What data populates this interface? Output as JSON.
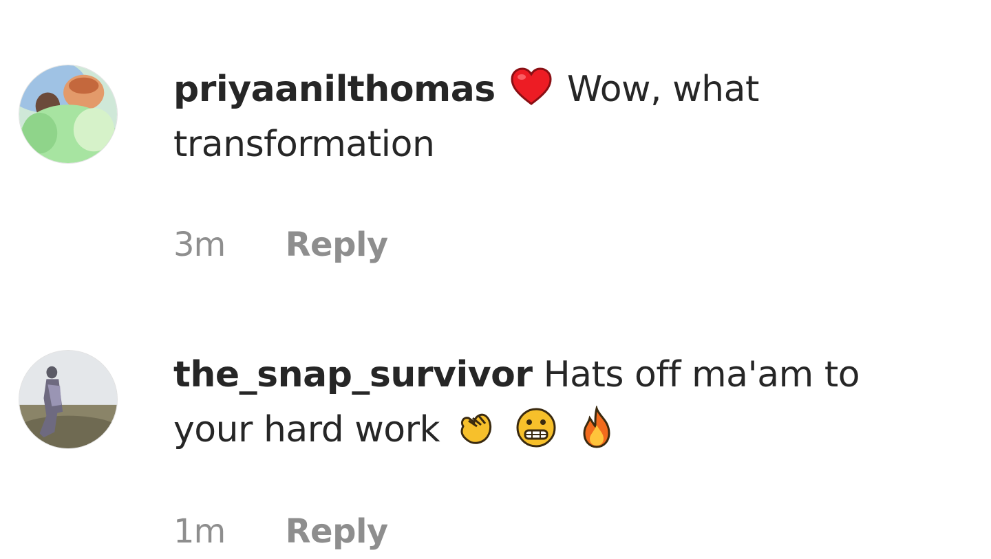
{
  "comments": [
    {
      "username": "priyaanilthomas",
      "emoji_after_username": "red-heart-icon",
      "text_line1": "Wow, what",
      "text_line2": "transformation",
      "time": "3m",
      "reply_label": "Reply"
    },
    {
      "username": "the_snap_survivor",
      "text_line1": "Hats off ma'am to",
      "text_line2": "your hard work",
      "emojis": [
        "clapping-hands-icon",
        "grimacing-face-icon",
        "fire-icon"
      ],
      "time": "1m",
      "reply_label": "Reply"
    }
  ],
  "colors": {
    "text": "#262626",
    "meta": "#8e8e8e",
    "heart": "#ed1c24"
  }
}
